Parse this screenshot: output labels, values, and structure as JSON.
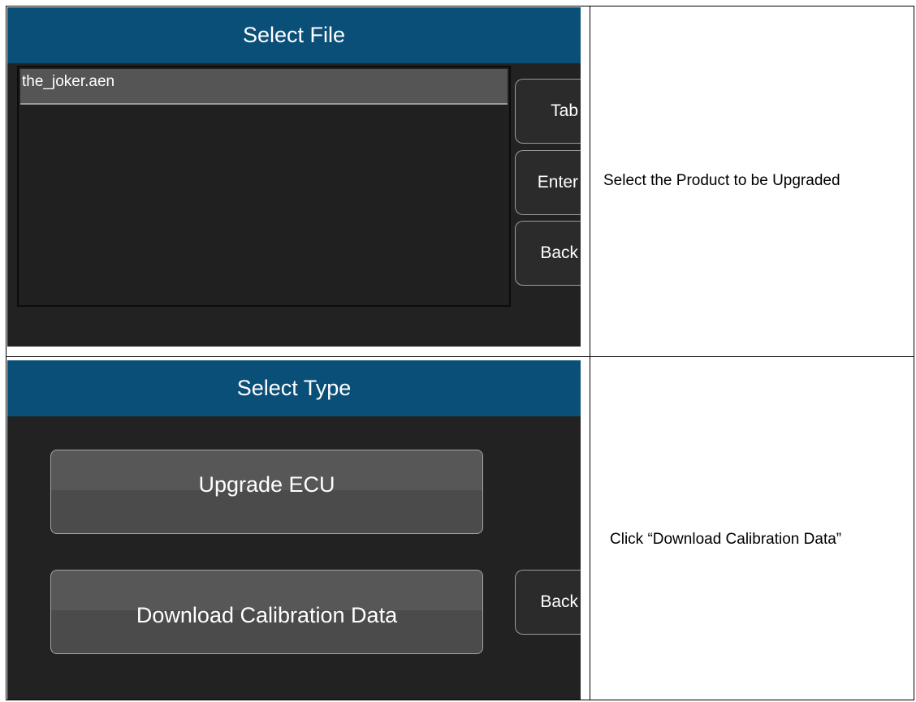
{
  "rows": [
    {
      "screen": {
        "title": "Select File",
        "files": [
          "the_joker.aen"
        ],
        "buttons": {
          "tab": "Tab",
          "enter": "Enter",
          "back": "Back"
        }
      },
      "instruction": "Select the Product to be Upgraded"
    },
    {
      "screen": {
        "title": "Select Type",
        "options": [
          "Upgrade ECU",
          "Download Calibration Data"
        ],
        "buttons": {
          "back": "Back"
        }
      },
      "instruction": "Click “Download Calibration Data”"
    }
  ],
  "colors": {
    "title_bar": "#0a4f78",
    "screen_background": "#222222",
    "selected_row": "#555555"
  }
}
